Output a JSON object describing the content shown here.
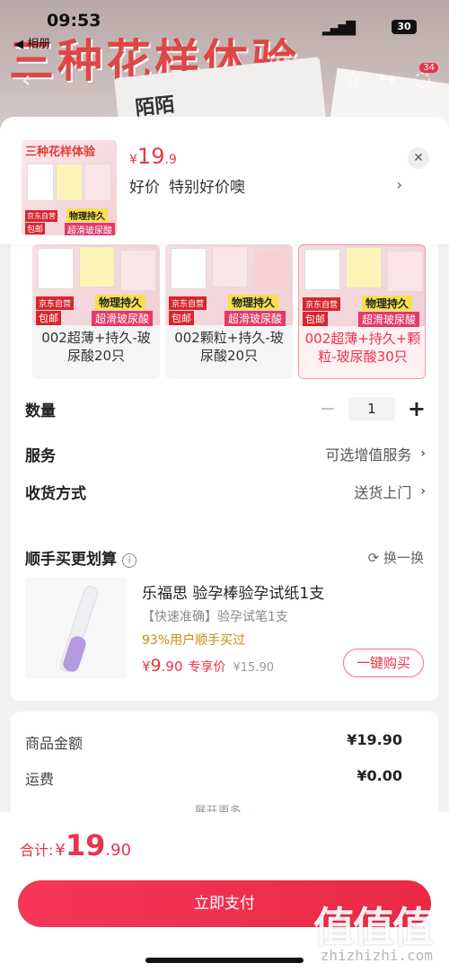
{
  "status_bar": {
    "time": "09:53",
    "back_app": "◀ 相册",
    "battery": "30"
  },
  "background": {
    "banner_text": "三种花样体验",
    "box_text": "陌陌",
    "cart_badge": "34"
  },
  "header": {
    "thumb_title": "三种花样体验",
    "thumb_tag_1": "京东自营",
    "thumb_tag_2": "包邮",
    "thumb_tag_3": "物理持久",
    "thumb_tag_4": "超滑玻尿酸",
    "price_currency": "¥",
    "price_int": "19",
    "price_dec": ".9",
    "promo_label": "好价",
    "promo_text": "特别好价噢",
    "arrow": "›",
    "close": "✕"
  },
  "skus": [
    {
      "label": "002超薄+持久-玻尿酸20只",
      "badge_a": "京东自营",
      "badge_b": "包邮",
      "badge_c": "物理持久",
      "badge_d": "超滑玻尿酸",
      "selected": false
    },
    {
      "label": "002颗粒+持久-玻尿酸20只",
      "badge_a": "京东自营",
      "badge_b": "包邮",
      "badge_c": "物理持久",
      "badge_d": "超滑玻尿酸",
      "selected": false
    },
    {
      "label": "002超薄+持久+颗粒-玻尿酸30只",
      "badge_a": "京东自营",
      "badge_b": "包邮",
      "badge_c": "物理持久",
      "badge_d": "超滑玻尿酸",
      "selected": true
    }
  ],
  "quantity": {
    "label": "数量",
    "value": "1",
    "minus": "−",
    "plus": "+"
  },
  "service": {
    "label": "服务",
    "value": "可选增值服务",
    "arrow": "›"
  },
  "delivery": {
    "label": "收货方式",
    "value": "送货上门",
    "arrow": "›"
  },
  "recommend": {
    "title": "顺手买更划算",
    "info": "i",
    "refresh": "⟳ 换一换",
    "name": "乐福思 验孕棒验孕试纸1支",
    "sub": "【快速准确】验孕试笔1支",
    "pct": "93%用户顺手买过",
    "price_cur": "¥",
    "price_int": "9",
    "price_dec": ".90",
    "exclusive": "专享价",
    "orig": "¥15.90",
    "button": "一键购买"
  },
  "summary": {
    "goods_label": "商品金额",
    "goods_value": "¥19.90",
    "ship_label": "运费",
    "ship_value": "¥0.00",
    "more": "展开更多 ⌄"
  },
  "footer": {
    "total_label": "合计:",
    "total_cur": "¥",
    "total_int": "19",
    "total_dec": ".90",
    "pay_button": "立即支付"
  },
  "watermark": {
    "text": "值值值",
    "sub": "zhizhizhi.com"
  },
  "colors": {
    "accent": "#e8344a",
    "gold": "#c88a14",
    "background": "#f2f2f4"
  }
}
